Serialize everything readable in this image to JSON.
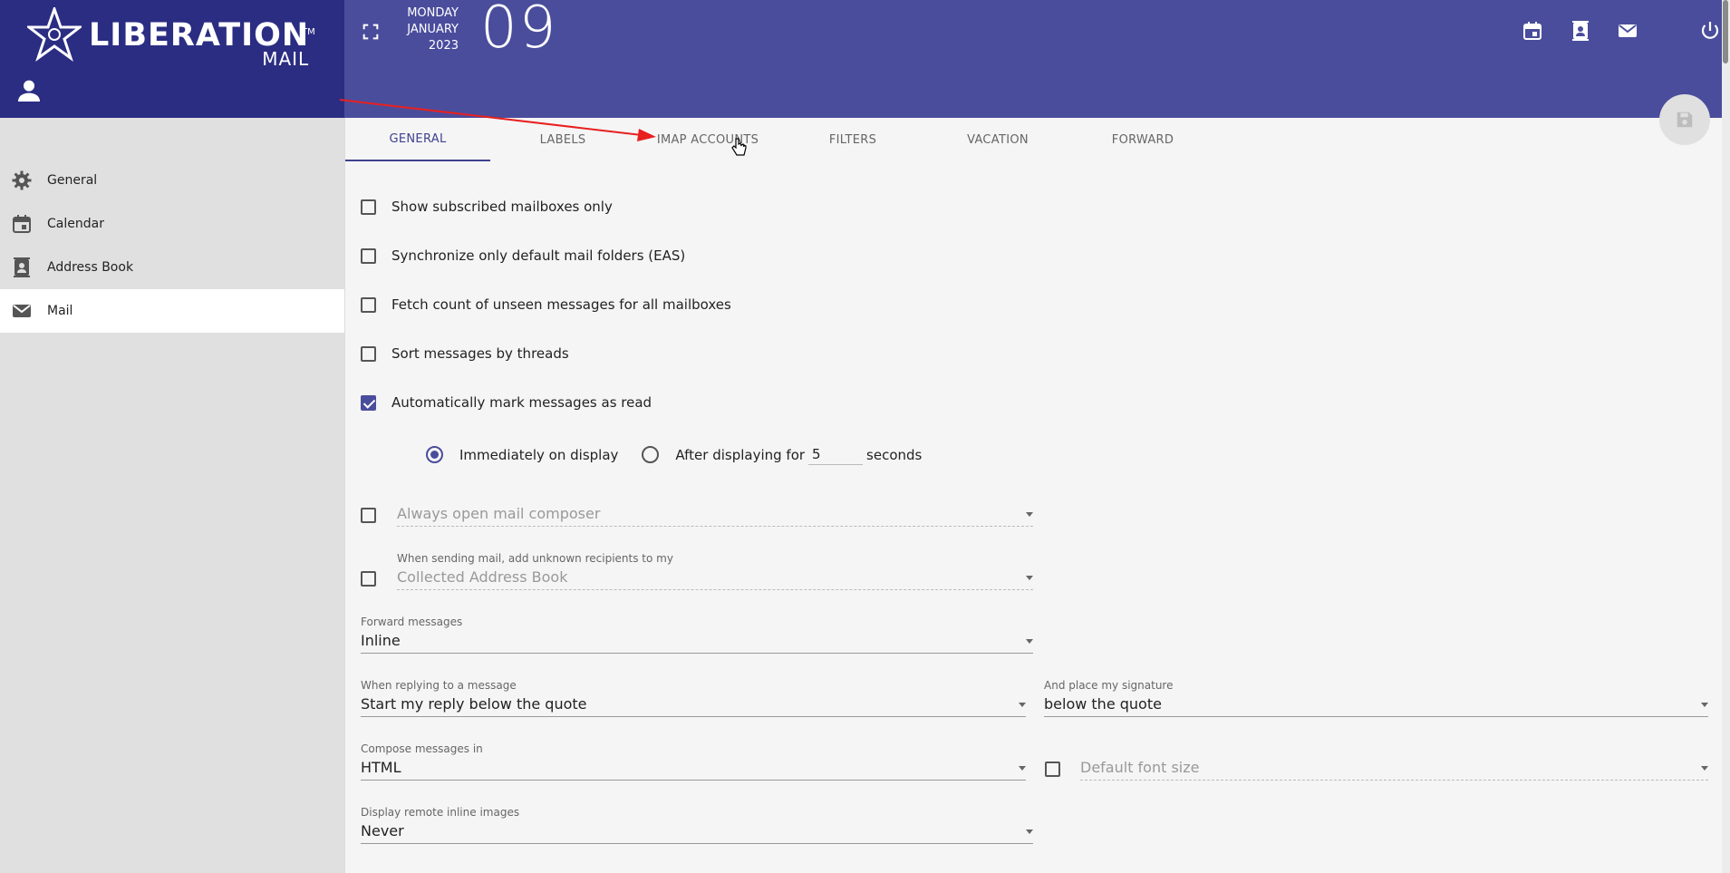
{
  "app": {
    "logo_word": "LIBERATION",
    "logo_sub": "MAIL",
    "logo_tm": "TM"
  },
  "header": {
    "weekday": "MONDAY",
    "month": "JANUARY",
    "year": "2023",
    "day": "09",
    "icons": [
      "calendar-icon",
      "contacts-icon",
      "mail-icon",
      "power-icon"
    ]
  },
  "sidebar": {
    "items": [
      {
        "label": "General",
        "icon": "gear-icon"
      },
      {
        "label": "Calendar",
        "icon": "calendar-icon"
      },
      {
        "label": "Address Book",
        "icon": "contacts-icon"
      },
      {
        "label": "Mail",
        "icon": "mail-icon",
        "active": true
      }
    ]
  },
  "tabs": [
    {
      "label": "GENERAL",
      "active": true
    },
    {
      "label": "LABELS"
    },
    {
      "label": "IMAP ACCOUNTS"
    },
    {
      "label": "FILTERS"
    },
    {
      "label": "VACATION"
    },
    {
      "label": "FORWARD"
    }
  ],
  "options": {
    "subscribed_only": {
      "label": "Show subscribed mailboxes only",
      "checked": false
    },
    "sync_default": {
      "label": "Synchronize only default mail folders (EAS)",
      "checked": false
    },
    "fetch_unseen": {
      "label": "Fetch count of unseen messages for all mailboxes",
      "checked": false
    },
    "sort_threads": {
      "label": "Sort messages by threads",
      "checked": false
    },
    "auto_mark_read": {
      "label": "Automatically mark messages as read",
      "checked": true
    },
    "mark_immediately": "Immediately on display",
    "mark_after": "After displaying for",
    "mark_after_seconds": "5",
    "seconds_label": "seconds"
  },
  "fields": {
    "always_open_composer": {
      "value": "Always open mail composer"
    },
    "collect_recipients": {
      "label": "When sending mail, add unknown recipients to my",
      "value": "Collected Address Book"
    },
    "forward_messages": {
      "label": "Forward messages",
      "value": "Inline"
    },
    "reply_position": {
      "label": "When replying to a message",
      "value": "Start my reply below the quote"
    },
    "signature_position": {
      "label": "And place my signature",
      "value": "below the quote"
    },
    "compose_format": {
      "label": "Compose messages in",
      "value": "HTML"
    },
    "default_font_size": {
      "value": "Default font size"
    },
    "remote_images": {
      "label": "Display remote inline images",
      "value": "Never"
    }
  },
  "colors": {
    "header_left": "#2b2d83",
    "header_right": "#4a4d9c",
    "accent": "#3f418f",
    "annotation_arrow": "#e8201f"
  }
}
